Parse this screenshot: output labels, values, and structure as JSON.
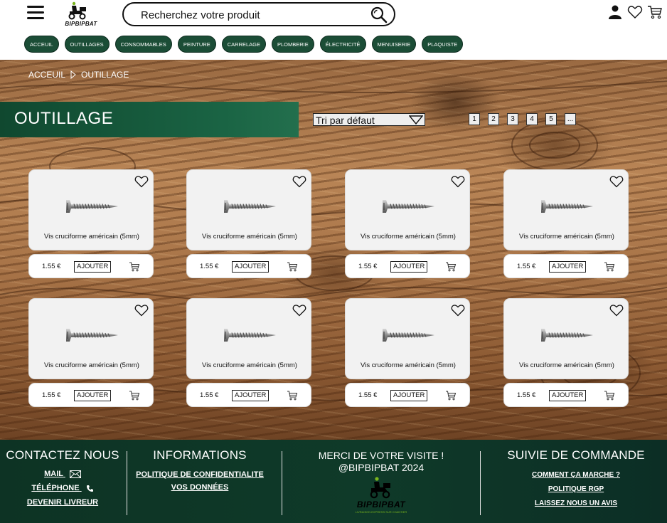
{
  "header": {
    "logo_text": "BIPBIPBAT",
    "search_placeholder": "Recherchez votre produit",
    "search_value": "",
    "icons": [
      "menu-icon",
      "search-icon",
      "user-icon",
      "heart-icon",
      "cart-icon"
    ]
  },
  "categories": [
    "ACCEUIL",
    "OUTILLAGES",
    "CONSOMMABLES",
    "PEINTURE",
    "CARRELAGE",
    "PLOMBERIE",
    "ÉLECTRICITÉ",
    "MENUISERIE",
    "PLAQUISTE"
  ],
  "breadcrumb": {
    "home": "ACCEUIL",
    "separator_icon": "triangle-right-icon",
    "current": "OUTILLAGE"
  },
  "page_title": "OUTILLAGE",
  "sort": {
    "selected": "Tri par défaut"
  },
  "pagination": [
    "1",
    "2",
    "3",
    "4",
    "5",
    "..."
  ],
  "products": [
    {
      "name": "Vis cruciforme américain (5mm)",
      "price": "1.55 €",
      "add_label": "AJOUTER"
    },
    {
      "name": "Vis cruciforme américain (5mm)",
      "price": "1.55 €",
      "add_label": "AJOUTER"
    },
    {
      "name": "Vis cruciforme américain (5mm)",
      "price": "1.55 €",
      "add_label": "AJOUTER"
    },
    {
      "name": "Vis cruciforme américain (5mm)",
      "price": "1.55 €",
      "add_label": "AJOUTER"
    },
    {
      "name": "Vis cruciforme américain (5mm)",
      "price": "1.55 €",
      "add_label": "AJOUTER"
    },
    {
      "name": "Vis cruciforme américain (5mm)",
      "price": "1.55 €",
      "add_label": "AJOUTER"
    },
    {
      "name": "Vis cruciforme américain (5mm)",
      "price": "1.55 €",
      "add_label": "AJOUTER"
    },
    {
      "name": "Vis cruciforme américain (5mm)",
      "price": "1.55 €",
      "add_label": "AJOUTER"
    }
  ],
  "footer": {
    "contact": {
      "title": "CONTACTEZ NOUS",
      "mail": "MAIL",
      "phone": "TÉLÉPHONE",
      "driver": "DEVENIR LIVREUR"
    },
    "info": {
      "title": "INFORMATIONS",
      "privacy": "POLITIQUE DE CONFIDENTIALITE",
      "data": "VOS DONNÉES"
    },
    "thanks": {
      "line1": "MERCI DE VOTRE VISITE !",
      "line2": "@BIPBIPBAT 2024",
      "logo_text": "BIPBIPBAT",
      "tagline": "LIVRAISON EXPRESS SUR CHANTIER"
    },
    "order": {
      "title": "SUIVIE DE COMMANDE",
      "how": "COMMENT ÇA MARCHE ?",
      "rgp": "POLITIQUE RGP",
      "review": "LAISSEZ NOUS UN AVIS"
    }
  },
  "colors": {
    "brand_green": "#1b4d36",
    "footer_green": "#0f3a29",
    "accent_lime": "#7ab51d"
  }
}
